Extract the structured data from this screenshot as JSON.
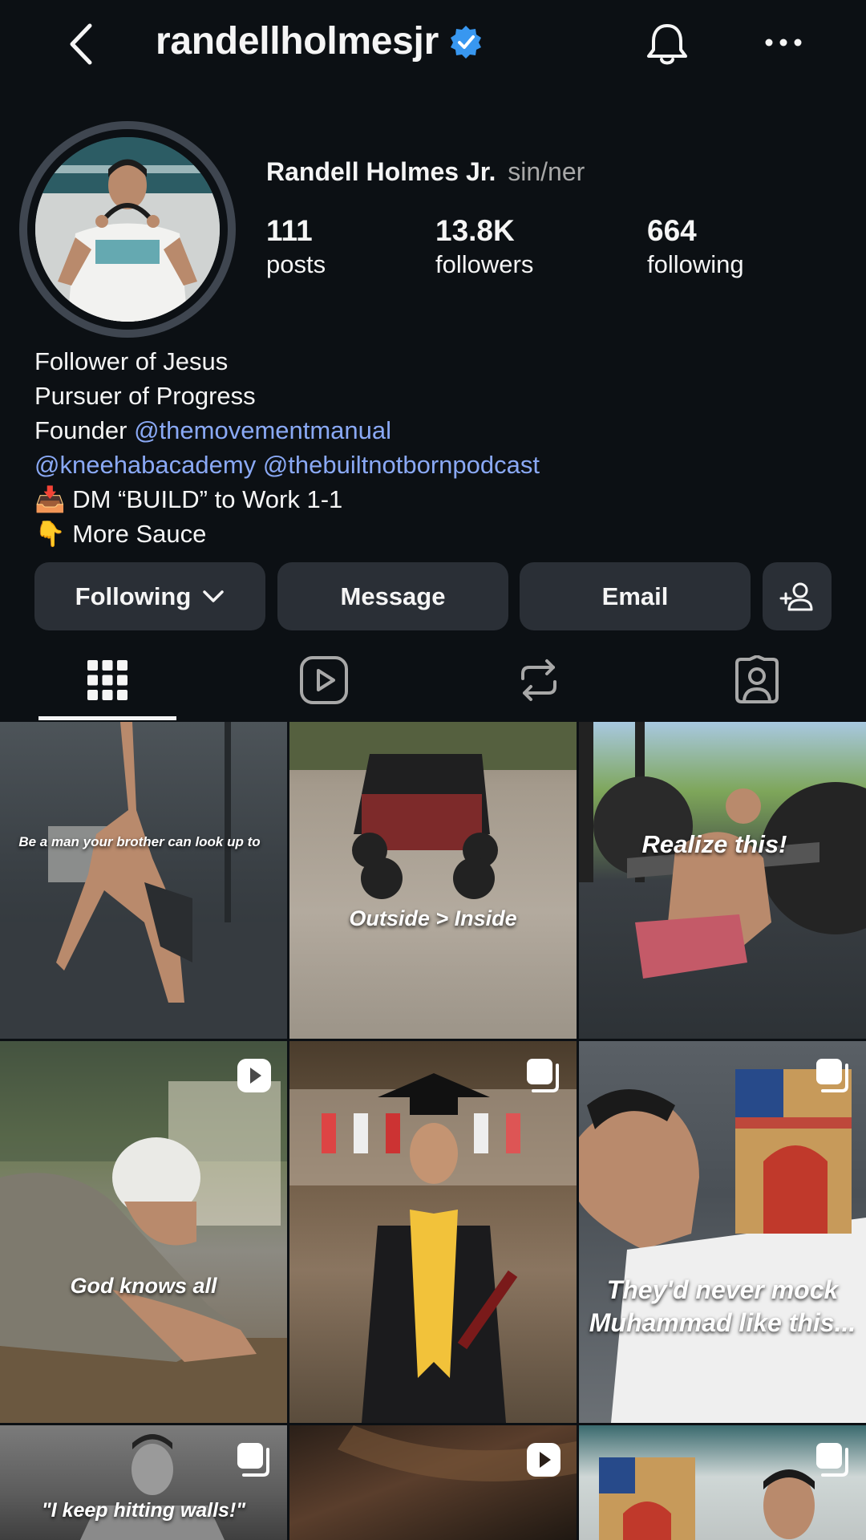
{
  "header": {
    "username": "randellholmesjr",
    "verified": true,
    "accent_color": "#3897f0"
  },
  "profile": {
    "full_name": "Randell Holmes Jr.",
    "pronouns": "sin/ner",
    "stats": [
      {
        "value": "111",
        "label": "posts"
      },
      {
        "value": "13.8K",
        "label": "followers"
      },
      {
        "value": "664",
        "label": "following"
      }
    ],
    "bio": {
      "line1": "Follower of Jesus",
      "line2": "Pursuer of Progress",
      "line3_prefix": "Founder ",
      "line3_mention": "@themovementmanual",
      "line4_mention1": "@kneehabacademy",
      "line4_mention2": "@thebuiltnotbornpodcast",
      "line5_emoji": "📥",
      "line5_text": "DM “BUILD” to Work 1-1",
      "line6_emoji": "👇",
      "line6_text": "More Sauce"
    }
  },
  "actions": {
    "following": "Following",
    "message": "Message",
    "email": "Email"
  },
  "tabs": [
    "grid-icon",
    "reels-icon",
    "reposts-icon",
    "tagged-icon"
  ],
  "posts": [
    {
      "caption": "Be a man your brother can look up to",
      "badge": ""
    },
    {
      "caption": "Outside > Inside",
      "badge": ""
    },
    {
      "caption": "Realize this!",
      "badge": ""
    },
    {
      "caption": "God knows all",
      "badge": "reel-icon"
    },
    {
      "caption": "",
      "badge": "carousel-icon"
    },
    {
      "caption": "They'd never mock Muhammad like this...",
      "badge": "carousel-icon"
    },
    {
      "caption": "\"I keep hitting walls!\"",
      "badge": "carousel-icon"
    },
    {
      "caption": "",
      "badge": "reel-icon"
    },
    {
      "caption": "",
      "badge": "carousel-icon"
    }
  ]
}
